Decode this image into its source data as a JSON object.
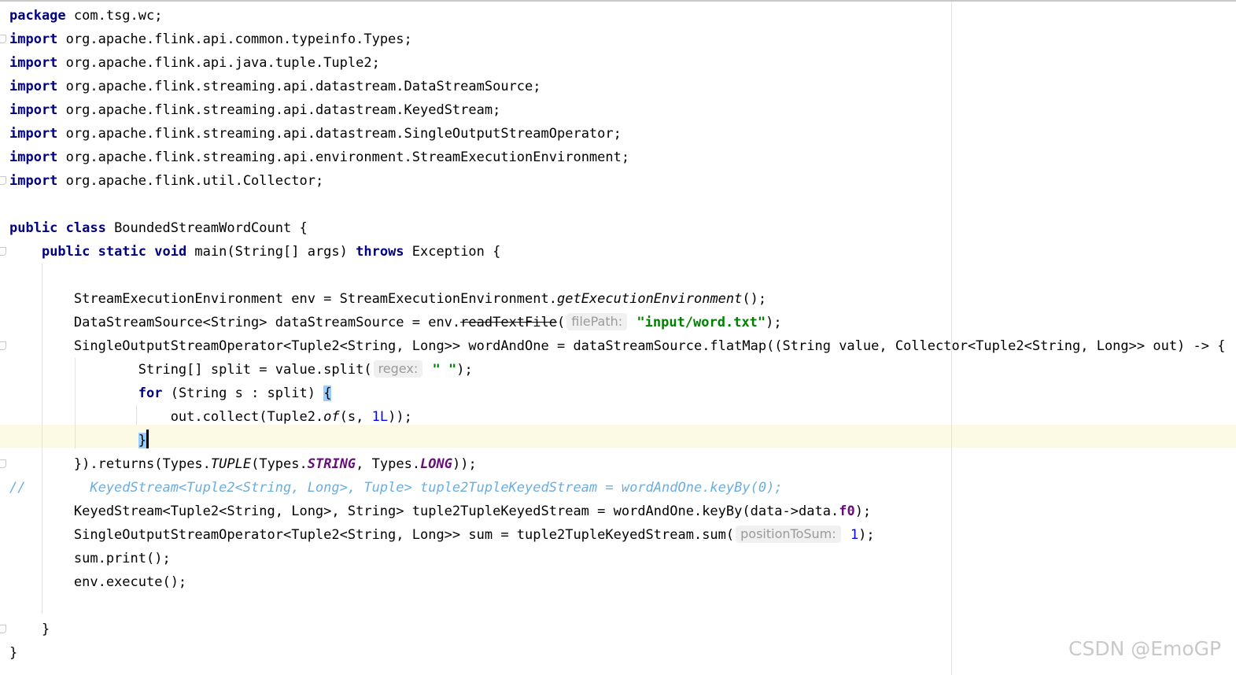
{
  "editor": {
    "lines": [
      [
        {
          "t": "package",
          "c": "kw"
        },
        {
          "t": " com.tsg.wc;"
        }
      ],
      [
        {
          "t": "import",
          "c": "kw"
        },
        {
          "t": " org.apache.flink.api.common.typeinfo.Types;"
        }
      ],
      [
        {
          "t": "import",
          "c": "kw"
        },
        {
          "t": " org.apache.flink.api.java.tuple.Tuple2;"
        }
      ],
      [
        {
          "t": "import",
          "c": "kw"
        },
        {
          "t": " org.apache.flink.streaming.api.datastream.DataStreamSource;"
        }
      ],
      [
        {
          "t": "import",
          "c": "kw"
        },
        {
          "t": " org.apache.flink.streaming.api.datastream.KeyedStream;"
        }
      ],
      [
        {
          "t": "import",
          "c": "kw"
        },
        {
          "t": " org.apache.flink.streaming.api.datastream.SingleOutputStreamOperator;"
        }
      ],
      [
        {
          "t": "import",
          "c": "kw"
        },
        {
          "t": " org.apache.flink.streaming.api.environment.StreamExecutionEnvironment;"
        }
      ],
      [
        {
          "t": "import",
          "c": "kw"
        },
        {
          "t": " org.apache.flink.util.Collector;"
        }
      ],
      [],
      [
        {
          "t": "public class",
          "c": "kw"
        },
        {
          "t": " BoundedStreamWordCount {"
        }
      ],
      [
        {
          "t": "    "
        },
        {
          "t": "public static void",
          "c": "kw"
        },
        {
          "t": " main(String[] args) "
        },
        {
          "t": "throws",
          "c": "kw"
        },
        {
          "t": " Exception {"
        }
      ],
      [],
      [
        {
          "t": "        StreamExecutionEnvironment env = StreamExecutionEnvironment."
        },
        {
          "t": "getExecutionEnvironment",
          "c": "ital"
        },
        {
          "t": "();"
        }
      ],
      [
        {
          "t": "        DataStreamSource<String> dataStreamSource = env."
        },
        {
          "t": "readTextFile",
          "c": "strike"
        },
        {
          "t": "("
        },
        {
          "t": "filePath:",
          "c": "hint"
        },
        {
          "t": " "
        },
        {
          "t": "\"input/word.txt\"",
          "c": "str"
        },
        {
          "t": ");"
        }
      ],
      [
        {
          "t": "        SingleOutputStreamOperator<Tuple2<String, Long>> wordAndOne = dataStreamSource.flatMap((String value, Collector<Tuple2<String, Long>> out) -> {"
        }
      ],
      [
        {
          "t": "                String[] split = value.split("
        },
        {
          "t": "regex:",
          "c": "hint"
        },
        {
          "t": " "
        },
        {
          "t": "\" \"",
          "c": "str"
        },
        {
          "t": ");"
        }
      ],
      [
        {
          "t": "                "
        },
        {
          "t": "for",
          "c": "kw"
        },
        {
          "t": " (String s : split) "
        },
        {
          "t": "{",
          "c": "brace-match"
        }
      ],
      [
        {
          "t": "                    out.collect(Tuple2."
        },
        {
          "t": "of",
          "c": "ital"
        },
        {
          "t": "(s, "
        },
        {
          "t": "1L",
          "c": "num"
        },
        {
          "t": "));"
        }
      ],
      [
        {
          "t": "                "
        },
        {
          "t": "}",
          "c": "brace-match"
        },
        {
          "t": "",
          "c": "cursor"
        }
      ],
      [
        {
          "t": "        })."
        },
        {
          "t": "returns"
        },
        {
          "t": "(Types."
        },
        {
          "t": "TUPLE",
          "c": "ital"
        },
        {
          "t": "(Types."
        },
        {
          "t": "STRING",
          "c": "const"
        },
        {
          "t": ", Types."
        },
        {
          "t": "LONG",
          "c": "const"
        },
        {
          "t": "));"
        }
      ],
      [
        {
          "t": "//        KeyedStream<Tuple2<String, Long>, Tuple> tuple2TupleKeyedStream = wordAndOne.keyBy(0);",
          "c": "comment"
        }
      ],
      [
        {
          "t": "        KeyedStream<Tuple2<String, Long>, String> tuple2TupleKeyedStream = wordAndOne.keyBy(data->data."
        },
        {
          "t": "f0",
          "c": "field"
        },
        {
          "t": ");"
        }
      ],
      [
        {
          "t": "        SingleOutputStreamOperator<Tuple2<String, Long>> sum = tuple2TupleKeyedStream.sum("
        },
        {
          "t": "positionToSum:",
          "c": "hint"
        },
        {
          "t": " "
        },
        {
          "t": "1",
          "c": "num"
        },
        {
          "t": ");"
        }
      ],
      [
        {
          "t": "        sum.print();"
        }
      ],
      [
        {
          "t": "        env.execute();"
        }
      ],
      [],
      [
        {
          "t": "    }"
        }
      ],
      [
        {
          "t": "}"
        }
      ]
    ]
  },
  "watermark": "CSDN @EmoGP"
}
